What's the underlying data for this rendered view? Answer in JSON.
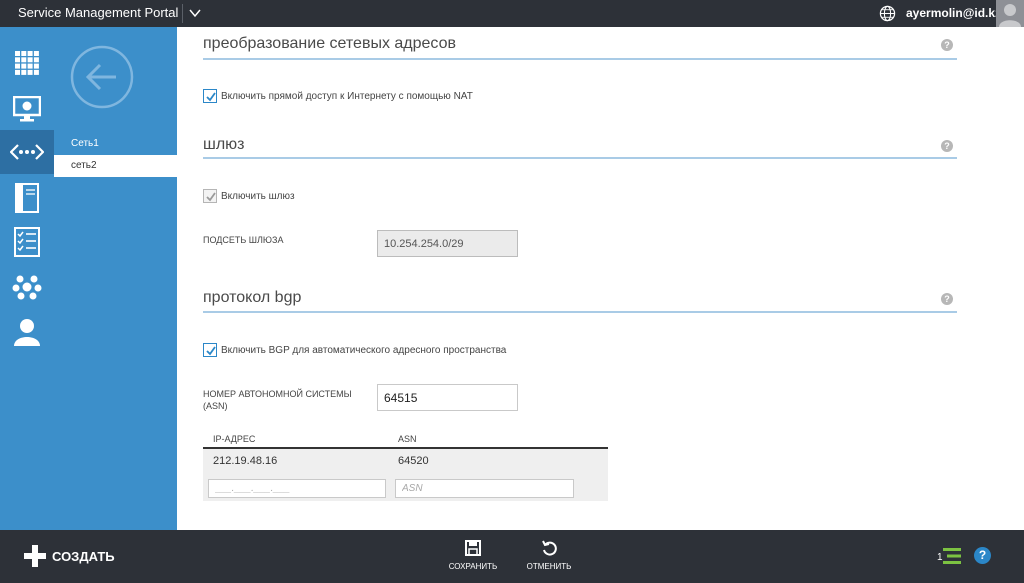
{
  "topbar": {
    "brand": "Service Management Portal",
    "user": "ayermolin@id.kz"
  },
  "subnav": {
    "items": [
      {
        "label": "Сеть1",
        "active": false
      },
      {
        "label": "сеть2",
        "active": true
      }
    ]
  },
  "nat": {
    "title": "преобразование сетевых адресов",
    "checkbox_label": "Включить прямой доступ к Интернету с помощью NAT",
    "checked": true
  },
  "gateway": {
    "title": "шлюз",
    "checkbox_label": "Включить шлюз",
    "checked": true,
    "subnet_label": "ПОДСЕТЬ ШЛЮЗА",
    "subnet_value": "10.254.254.0/29"
  },
  "bgp": {
    "title": "протокол bgp",
    "checkbox_label": "Включить BGP для автоматического адресного пространства",
    "checked": true,
    "asn_label_line1": "НОМЕР АВТОНОМНОЙ СИСТЕМЫ",
    "asn_label_line2": "(ASN)",
    "asn_value": "64515",
    "table": {
      "headers": [
        "IP-АДРЕС",
        "ASN"
      ],
      "rows": [
        {
          "ip": "212.19.48.16",
          "asn": "64520"
        }
      ],
      "ip_placeholder": "___.___.___.___",
      "asn_placeholder": "ASN"
    }
  },
  "help_glyph": "?",
  "bottombar": {
    "create_label": "СОЗДАТЬ",
    "save_label": "СОХРАНИТЬ",
    "cancel_label": "ОТМЕНИТЬ",
    "ops_count": "1",
    "help_glyph": "?"
  },
  "colors": {
    "topbar": "#2d3138",
    "nav": "#3c8fca",
    "nav_active": "#2d6fa3",
    "accent": "#2b87c8",
    "section_line": "#a9cbe6"
  }
}
